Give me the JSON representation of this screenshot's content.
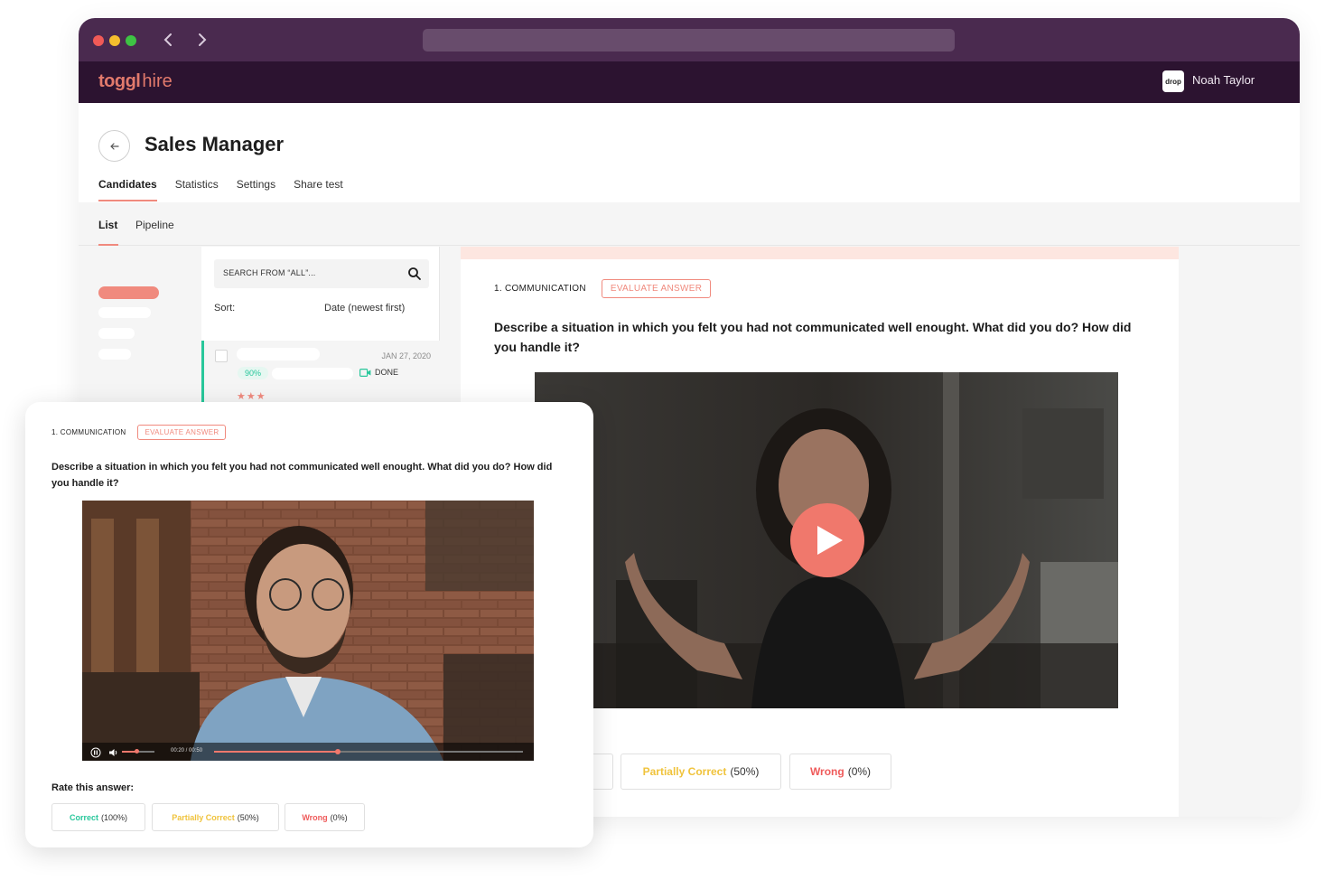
{
  "app": {
    "logo_primary": "toggl",
    "logo_secondary": "hire",
    "org_logo_text": "drop",
    "user_name": "Noah Taylor"
  },
  "page": {
    "title": "Sales Manager",
    "tabs": [
      {
        "label": "Candidates",
        "active": true
      },
      {
        "label": "Statistics",
        "active": false
      },
      {
        "label": "Settings",
        "active": false
      },
      {
        "label": "Share test",
        "active": false
      }
    ],
    "subtabs": [
      {
        "label": "List",
        "active": true
      },
      {
        "label": "Pipeline",
        "active": false
      }
    ]
  },
  "candidates": {
    "search_placeholder": "SEARCH FROM “ALL”...",
    "sort_label": "Sort:",
    "sort_value": "Date (newest first)",
    "rows": [
      {
        "date": "JAN 27, 2020",
        "score": "90%",
        "status": "DONE",
        "stars": "★★★"
      }
    ]
  },
  "answer_main": {
    "question_label": "1. COMMUNICATION",
    "evaluate_label": "EVALUATE ANSWER",
    "question_text": "Describe a situation in which you felt you had not communicated well enought. What did you do? How did you handle it?",
    "rate_heading_partial": "r:",
    "rate_options": [
      {
        "label": "Partially Correct",
        "value": "(50%)"
      },
      {
        "label": "Wrong",
        "value": "(0%)"
      }
    ]
  },
  "answer_overlay": {
    "question_label": "1. COMMUNICATION",
    "evaluate_label": "EVALUATE ANSWER",
    "question_text": "Describe a situation in which you felt you had not communicated well enought. What did you do? How did you handle it?",
    "video_time": "00:20 / 00:50",
    "video_progress": 0.4,
    "volume_level": 0.45,
    "rate_heading": "Rate this answer:",
    "rate_options": [
      {
        "label": "Correct",
        "value": "(100%)"
      },
      {
        "label": "Partially Correct",
        "value": "(50%)"
      },
      {
        "label": "Wrong",
        "value": "(0%)"
      }
    ]
  },
  "colors": {
    "accent": "#f08a7e",
    "correct": "#28c79b",
    "partial": "#f0c33c",
    "wrong": "#ef5b5b",
    "appbar": "#2c1330",
    "titlebar": "#4a2a4f"
  },
  "icons": [
    "back-arrow-icon",
    "search-icon",
    "video-camera-icon",
    "play-icon",
    "pause-icon",
    "volume-icon",
    "chevron-left-icon",
    "chevron-right-icon"
  ]
}
